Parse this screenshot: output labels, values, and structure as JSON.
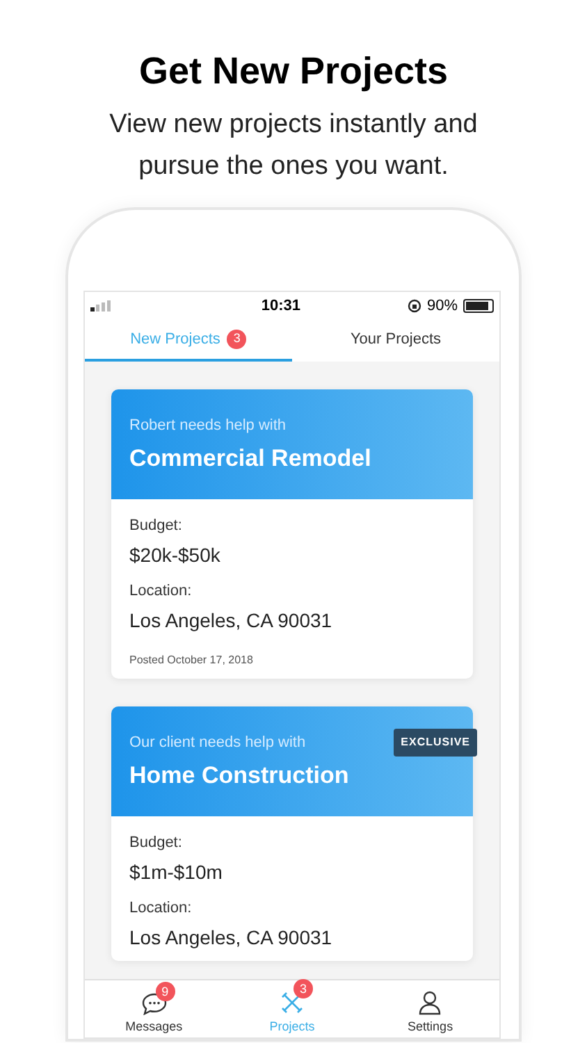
{
  "headline": "Get New Projects",
  "subtitle": "View new projects instantly and pursue the ones you want.",
  "status_bar": {
    "time": "10:31",
    "battery": "90%",
    "level": 0.9
  },
  "tabs": [
    {
      "label": "New Projects",
      "badge": "3",
      "selected": true
    },
    {
      "label": "Your Projects",
      "selected": false
    }
  ],
  "projects": [
    {
      "intro": "Robert needs help with",
      "title": "Commercial Remodel",
      "budget_label": "Budget:",
      "budget": "$20k-$50k",
      "location_label": "Location:",
      "location": "Los Angeles, CA 90031",
      "posted": "Posted October 17, 2018"
    },
    {
      "intro": "Our client needs help with",
      "title": "Home Construction",
      "tag": "EXCLUSIVE",
      "budget_label": "Budget:",
      "budget": "$1m-$10m",
      "location_label": "Location:",
      "location": "Los Angeles, CA 90031"
    }
  ],
  "bottom_nav": [
    {
      "kind": "messages",
      "label": "Messages",
      "badge": "9",
      "selected": false
    },
    {
      "kind": "projects",
      "label": "Projects",
      "badge": "3",
      "selected": true
    },
    {
      "kind": "settings",
      "label": "Settings",
      "selected": false
    }
  ]
}
